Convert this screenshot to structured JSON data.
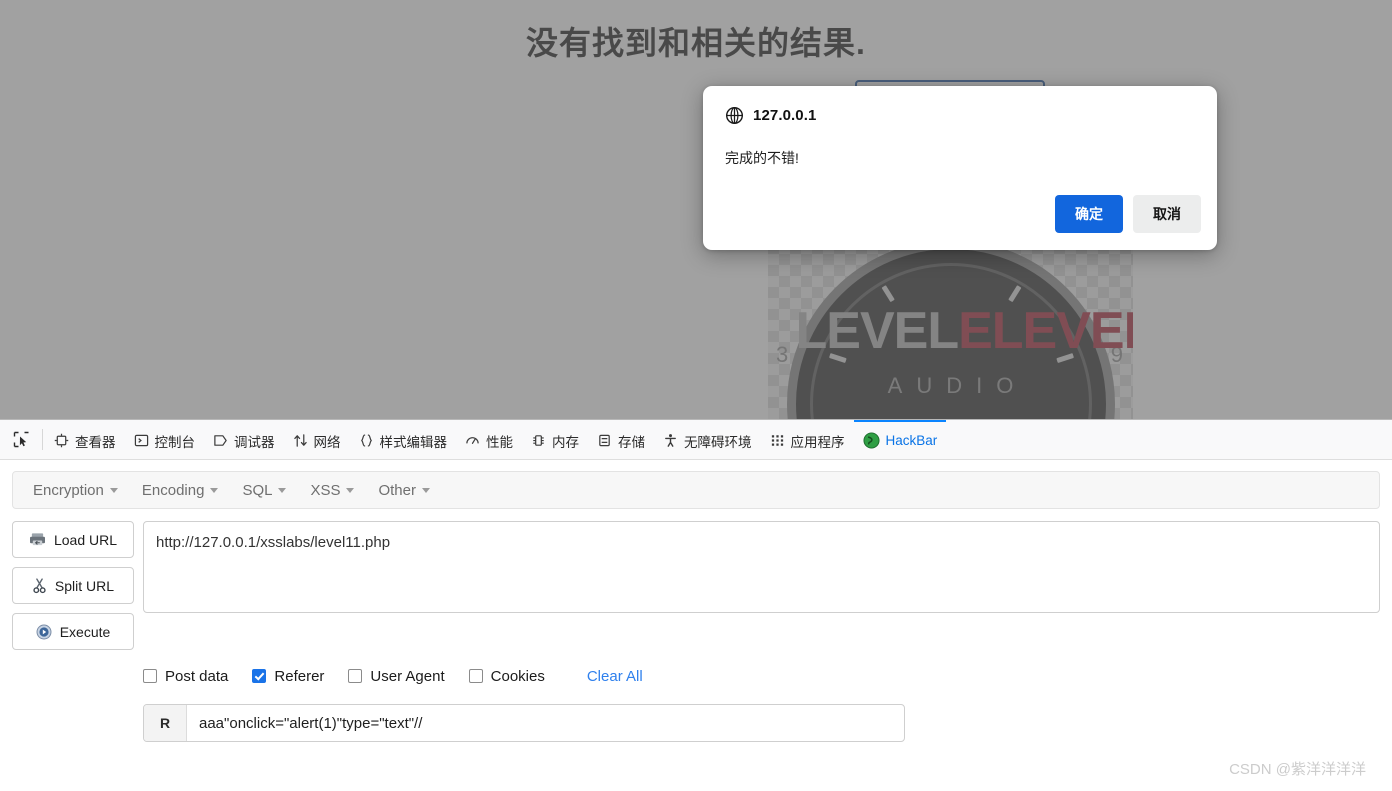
{
  "page": {
    "heading": "没有找到和相关的结果.",
    "search_value": "",
    "logo": {
      "text_part1": "LEVEL",
      "text_part2": "ELEVEN",
      "subtitle": "AUDIO",
      "number_left": "3",
      "number_right": "9"
    }
  },
  "dialog": {
    "origin": "127.0.0.1",
    "origin_icon": "globe-icon",
    "message": "完成的不错!",
    "confirm_label": "确定",
    "cancel_label": "取消",
    "confirm_color": "#1266dd",
    "cancel_color": "#eceded"
  },
  "devtools": {
    "picker_icon": "element-picker-icon",
    "tabs": [
      {
        "label": "查看器",
        "icon": "inspector-icon",
        "active": false
      },
      {
        "label": "控制台",
        "icon": "console-icon",
        "active": false
      },
      {
        "label": "调试器",
        "icon": "debugger-icon",
        "active": false
      },
      {
        "label": "网络",
        "icon": "network-icon",
        "active": false
      },
      {
        "label": "样式编辑器",
        "icon": "style-editor-icon",
        "active": false
      },
      {
        "label": "性能",
        "icon": "performance-icon",
        "active": false
      },
      {
        "label": "内存",
        "icon": "memory-icon",
        "active": false
      },
      {
        "label": "存储",
        "icon": "storage-icon",
        "active": false
      },
      {
        "label": "无障碍环境",
        "icon": "accessibility-icon",
        "active": false
      },
      {
        "label": "应用程序",
        "icon": "application-icon",
        "active": false
      },
      {
        "label": "HackBar",
        "icon": "hackbar-icon",
        "active": true
      }
    ],
    "active_tab_color": "#0a84ff"
  },
  "hackbar": {
    "menus": [
      {
        "label": "Encryption"
      },
      {
        "label": "Encoding"
      },
      {
        "label": "SQL"
      },
      {
        "label": "XSS"
      },
      {
        "label": "Other"
      }
    ],
    "buttons": [
      {
        "label": "Load URL",
        "icon": "load-url-icon"
      },
      {
        "label": "Split URL",
        "icon": "scissors-icon"
      },
      {
        "label": "Execute",
        "icon": "play-icon"
      }
    ],
    "url_value": "http://127.0.0.1/xsslabs/level11.php",
    "checkboxes": [
      {
        "label": "Post data",
        "checked": false
      },
      {
        "label": "Referer",
        "checked": true
      },
      {
        "label": "User Agent",
        "checked": false
      },
      {
        "label": "Cookies",
        "checked": false
      }
    ],
    "clear_all_label": "Clear All",
    "clear_all_color": "#2f80ed",
    "referer": {
      "tag": "R",
      "value": "aaa\"onclick=\"alert(1)\"type=\"text\"//"
    }
  },
  "watermark": "CSDN @紫洋洋洋洋"
}
